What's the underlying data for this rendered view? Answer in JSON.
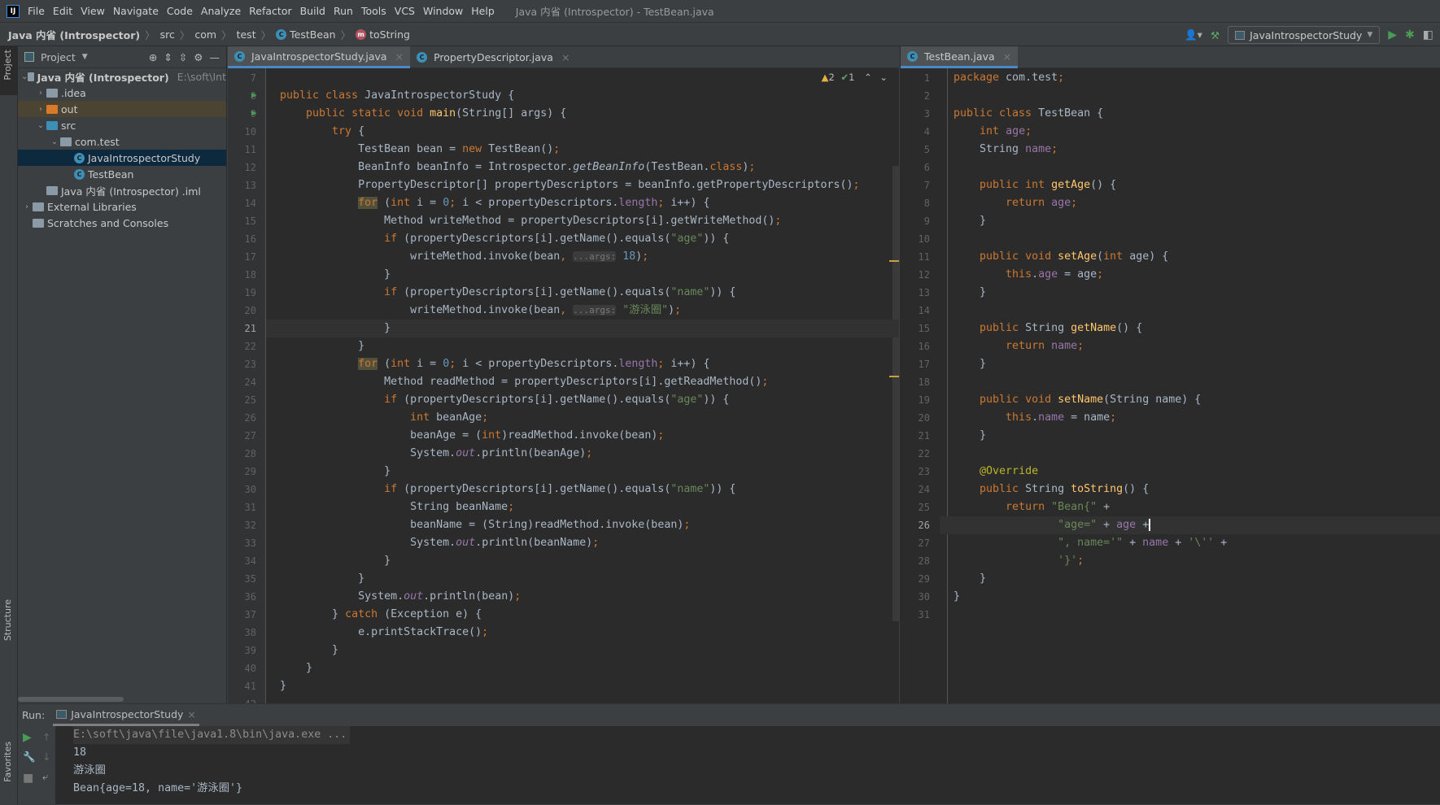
{
  "menu": [
    "File",
    "Edit",
    "View",
    "Navigate",
    "Code",
    "Analyze",
    "Refactor",
    "Build",
    "Run",
    "Tools",
    "VCS",
    "Window",
    "Help"
  ],
  "window_title": "Java 内省 (Introspector) - TestBean.java",
  "breadcrumb": [
    "Java 内省 (Introspector)",
    "src",
    "com",
    "test",
    "TestBean",
    "toString"
  ],
  "run_config": "JavaIntrospectorStudy",
  "strip": {
    "project": "Project",
    "structure": "Structure",
    "favorites": "Favorites"
  },
  "project": {
    "title": "Project",
    "root_path": "E:\\soft\\Int",
    "tree": [
      {
        "label": "Java 内省 (Introspector)",
        "depth": 0,
        "arrow": "open",
        "icon": "module",
        "bold": true
      },
      {
        "label": ".idea",
        "depth": 1,
        "arrow": "closed",
        "icon": "folder"
      },
      {
        "label": "out",
        "depth": 1,
        "arrow": "closed",
        "icon": "folder-orange",
        "state": "out"
      },
      {
        "label": "src",
        "depth": 1,
        "arrow": "open",
        "icon": "folder-blue"
      },
      {
        "label": "com.test",
        "depth": 2,
        "arrow": "open",
        "icon": "package"
      },
      {
        "label": "JavaIntrospectorStudy",
        "depth": 3,
        "icon": "class",
        "state": "selected"
      },
      {
        "label": "TestBean",
        "depth": 3,
        "icon": "class"
      },
      {
        "label": "Java 内省 (Introspector) .iml",
        "depth": 1,
        "icon": "iml"
      },
      {
        "label": "External Libraries",
        "depth": 0,
        "arrow": "closed",
        "icon": "library"
      },
      {
        "label": "Scratches and Consoles",
        "depth": 0,
        "icon": "scratch"
      }
    ]
  },
  "left_tabs": [
    {
      "label": "JavaIntrospectorStudy.java",
      "active": true
    },
    {
      "label": "PropertyDescriptor.java",
      "active": false
    }
  ],
  "right_tabs": [
    {
      "label": "TestBean.java",
      "active": true
    }
  ],
  "inspections": {
    "warnings": "2",
    "weak_warnings": "1"
  },
  "left_editor": {
    "first_line": 7,
    "current_line": 21,
    "run_lines": [
      8,
      9
    ],
    "lines": [
      "",
      [
        [
          "k",
          "public class "
        ],
        [
          "p",
          "JavaIntrospectorStudy {"
        ]
      ],
      [
        [
          "p",
          "    "
        ],
        [
          "k",
          "public static void "
        ],
        [
          "m",
          "main"
        ],
        [
          "p",
          "(String[] args) {"
        ]
      ],
      [
        [
          "p",
          "        "
        ],
        [
          "k",
          "try "
        ],
        [
          "p",
          "{"
        ]
      ],
      [
        [
          "p",
          "            TestBean bean = "
        ],
        [
          "k",
          "new "
        ],
        [
          "p",
          "TestBean()"
        ],
        [
          "k",
          ";"
        ]
      ],
      [
        [
          "p",
          "            BeanInfo beanInfo = Introspector."
        ],
        [
          "i",
          "getBeanInfo"
        ],
        [
          "p",
          "(TestBean."
        ],
        [
          "k",
          "class"
        ],
        [
          "p",
          ")"
        ],
        [
          "k",
          ";"
        ]
      ],
      [
        [
          "p",
          "            PropertyDescriptor[] propertyDescriptors = beanInfo.getPropertyDescriptors()"
        ],
        [
          "k",
          ";"
        ]
      ],
      [
        [
          "p",
          "            "
        ],
        [
          "kh",
          "for"
        ],
        [
          "p",
          " ("
        ],
        [
          "k",
          "int "
        ],
        [
          "p",
          "i = "
        ],
        [
          "n",
          "0"
        ],
        [
          "k",
          "; "
        ],
        [
          "p",
          "i < propertyDescriptors."
        ],
        [
          "f",
          "length"
        ],
        [
          "k",
          "; "
        ],
        [
          "p",
          "i++) {"
        ]
      ],
      [
        [
          "p",
          "                Method writeMethod = propertyDescriptors[i].getWriteMethod()"
        ],
        [
          "k",
          ";"
        ]
      ],
      [
        [
          "p",
          "                "
        ],
        [
          "k",
          "if "
        ],
        [
          "p",
          "(propertyDescriptors[i].getName().equals("
        ],
        [
          "s",
          "\"age\""
        ],
        [
          "p",
          ")) {"
        ]
      ],
      [
        [
          "p",
          "                    writeMethod.invoke(bean"
        ],
        [
          "k",
          ", "
        ],
        [
          "h",
          "...args:"
        ],
        [
          "n",
          " 18"
        ],
        [
          "p",
          ")"
        ],
        [
          "k",
          ";"
        ]
      ],
      "                }",
      [
        [
          "p",
          "                "
        ],
        [
          "k",
          "if "
        ],
        [
          "p",
          "(propertyDescriptors[i].getName().equals("
        ],
        [
          "s",
          "\"name\""
        ],
        [
          "p",
          ")) {"
        ]
      ],
      [
        [
          "p",
          "                    writeMethod.invoke(bean"
        ],
        [
          "k",
          ", "
        ],
        [
          "h",
          "...args:"
        ],
        [
          "s",
          " \"游泳圈\""
        ],
        [
          "p",
          ")"
        ],
        [
          "k",
          ";"
        ]
      ],
      "                }",
      "            }",
      [
        [
          "p",
          "            "
        ],
        [
          "kh",
          "for"
        ],
        [
          "p",
          " ("
        ],
        [
          "k",
          "int "
        ],
        [
          "p",
          "i = "
        ],
        [
          "n",
          "0"
        ],
        [
          "k",
          "; "
        ],
        [
          "p",
          "i < propertyDescriptors."
        ],
        [
          "f",
          "length"
        ],
        [
          "k",
          "; "
        ],
        [
          "p",
          "i++) {"
        ]
      ],
      [
        [
          "p",
          "                Method readMethod = propertyDescriptors[i].getReadMethod()"
        ],
        [
          "k",
          ";"
        ]
      ],
      [
        [
          "p",
          "                "
        ],
        [
          "k",
          "if "
        ],
        [
          "p",
          "(propertyDescriptors[i].getName().equals("
        ],
        [
          "s",
          "\"age\""
        ],
        [
          "p",
          ")) {"
        ]
      ],
      [
        [
          "p",
          "                    "
        ],
        [
          "k",
          "int "
        ],
        [
          "p",
          "beanAge"
        ],
        [
          "k",
          ";"
        ]
      ],
      [
        [
          "p",
          "                    beanAge = ("
        ],
        [
          "k",
          "int"
        ],
        [
          "p",
          ")readMethod.invoke(bean)"
        ],
        [
          "k",
          ";"
        ]
      ],
      [
        [
          "p",
          "                    System."
        ],
        [
          "fi",
          "out"
        ],
        [
          "p",
          ".println(beanAge)"
        ],
        [
          "k",
          ";"
        ]
      ],
      "                }",
      [
        [
          "p",
          "                "
        ],
        [
          "k",
          "if "
        ],
        [
          "p",
          "(propertyDescriptors[i].getName().equals("
        ],
        [
          "s",
          "\"name\""
        ],
        [
          "p",
          ")) {"
        ]
      ],
      [
        [
          "p",
          "                    String beanName"
        ],
        [
          "k",
          ";"
        ]
      ],
      [
        [
          "p",
          "                    beanName = (String)readMethod.invoke(bean)"
        ],
        [
          "k",
          ";"
        ]
      ],
      [
        [
          "p",
          "                    System."
        ],
        [
          "fi",
          "out"
        ],
        [
          "p",
          ".println(beanName)"
        ],
        [
          "k",
          ";"
        ]
      ],
      "                }",
      "            }",
      [
        [
          "p",
          "            System."
        ],
        [
          "fi",
          "out"
        ],
        [
          "p",
          ".println(bean)"
        ],
        [
          "k",
          ";"
        ]
      ],
      [
        [
          "p",
          "        } "
        ],
        [
          "k",
          "catch "
        ],
        [
          "p",
          "(Exception e) {"
        ]
      ],
      [
        [
          "p",
          "            e.printStackTrace()"
        ],
        [
          "k",
          ";"
        ]
      ],
      "        }",
      "    }",
      "}",
      ""
    ]
  },
  "right_editor": {
    "first_line": 1,
    "current_line": 26,
    "lines": [
      [
        [
          "k",
          "package "
        ],
        [
          "p",
          "com.test"
        ],
        [
          "k",
          ";"
        ]
      ],
      "",
      [
        [
          "k",
          "public class "
        ],
        [
          "p",
          "TestBean {"
        ]
      ],
      [
        [
          "p",
          "    "
        ],
        [
          "k",
          "int "
        ],
        [
          "f",
          "age"
        ],
        [
          "k",
          ";"
        ]
      ],
      [
        [
          "p",
          "    String "
        ],
        [
          "f",
          "name"
        ],
        [
          "k",
          ";"
        ]
      ],
      "",
      [
        [
          "p",
          "    "
        ],
        [
          "k",
          "public int "
        ],
        [
          "m",
          "getAge"
        ],
        [
          "p",
          "() {"
        ]
      ],
      [
        [
          "p",
          "        "
        ],
        [
          "k",
          "return "
        ],
        [
          "f",
          "age"
        ],
        [
          "k",
          ";"
        ]
      ],
      "    }",
      "",
      [
        [
          "p",
          "    "
        ],
        [
          "k",
          "public void "
        ],
        [
          "m",
          "setAge"
        ],
        [
          "p",
          "("
        ],
        [
          "k",
          "int "
        ],
        [
          "p",
          "age) {"
        ]
      ],
      [
        [
          "p",
          "        "
        ],
        [
          "k",
          "this"
        ],
        [
          "p",
          "."
        ],
        [
          "f",
          "age "
        ],
        [
          "p",
          "= age"
        ],
        [
          "k",
          ";"
        ]
      ],
      "    }",
      "",
      [
        [
          "p",
          "    "
        ],
        [
          "k",
          "public "
        ],
        [
          "p",
          "String "
        ],
        [
          "m",
          "getName"
        ],
        [
          "p",
          "() {"
        ]
      ],
      [
        [
          "p",
          "        "
        ],
        [
          "k",
          "return "
        ],
        [
          "f",
          "name"
        ],
        [
          "k",
          ";"
        ]
      ],
      "    }",
      "",
      [
        [
          "p",
          "    "
        ],
        [
          "k",
          "public void "
        ],
        [
          "m",
          "setName"
        ],
        [
          "p",
          "(String name) {"
        ]
      ],
      [
        [
          "p",
          "        "
        ],
        [
          "k",
          "this"
        ],
        [
          "p",
          "."
        ],
        [
          "f",
          "name "
        ],
        [
          "p",
          "= name"
        ],
        [
          "k",
          ";"
        ]
      ],
      "    }",
      "",
      [
        [
          "p",
          "    "
        ],
        [
          "a",
          "@Override"
        ]
      ],
      [
        [
          "p",
          "    "
        ],
        [
          "k",
          "public "
        ],
        [
          "p",
          "String "
        ],
        [
          "m",
          "toString"
        ],
        [
          "p",
          "() {"
        ]
      ],
      [
        [
          "p",
          "        "
        ],
        [
          "k",
          "return "
        ],
        [
          "s",
          "\"Bean{\" "
        ],
        [
          "p",
          "+"
        ]
      ],
      [
        [
          "p",
          "                "
        ],
        [
          "s",
          "\"age=\" "
        ],
        [
          "p",
          "+ "
        ],
        [
          "f",
          "age "
        ],
        [
          "p",
          "+"
        ]
      ],
      [
        [
          "p",
          "                "
        ],
        [
          "s",
          "\", name='\" "
        ],
        [
          "p",
          "+ "
        ],
        [
          "f",
          "name "
        ],
        [
          "p",
          "+ "
        ],
        [
          "s",
          "'\\''"
        ],
        [
          "p",
          " +"
        ]
      ],
      [
        [
          "p",
          "                "
        ],
        [
          "s",
          "'}'"
        ],
        [
          "k",
          ";"
        ]
      ],
      "    }",
      "}",
      ""
    ]
  },
  "run": {
    "label": "Run:",
    "tab": "JavaIntrospectorStudy",
    "output": [
      "E:\\soft\\java\\file\\java1.8\\bin\\java.exe ...",
      "18",
      "游泳圈",
      "Bean{age=18, name='游泳圈'}"
    ]
  },
  "colors": {
    "keyword": "#cc7832",
    "string": "#6a8759",
    "number": "#6897bb",
    "field": "#9876aa",
    "background": "#2b2b2b",
    "selection": "#0d293e",
    "accent": "#4a88c7"
  }
}
